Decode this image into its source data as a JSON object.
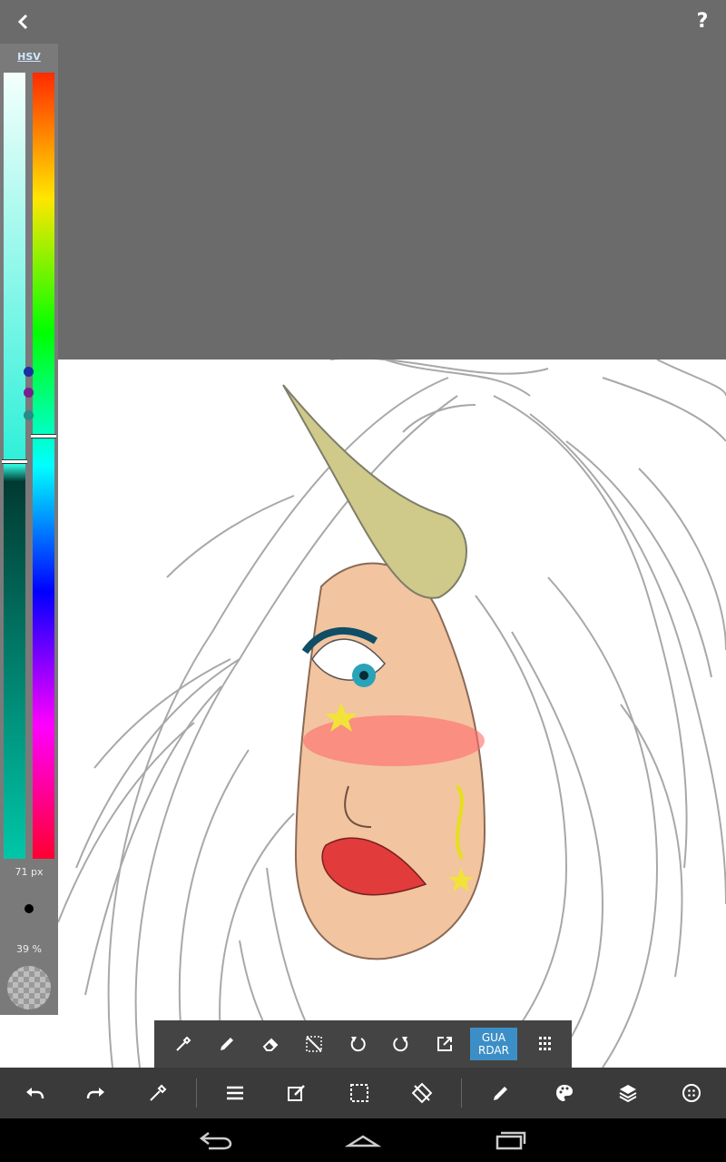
{
  "header": {
    "help_label": "?"
  },
  "color_panel": {
    "mode_label": "HSV",
    "brush_size": "71 px",
    "opacity": "39 %"
  },
  "toolbar": {
    "save_label": "GUA\nRDAR"
  },
  "colors": {
    "accent": "#3c8fc6",
    "selected_color": "#2cf0d8",
    "toolbar_bg": "#444444",
    "bottombar_bg": "#3a3a3a"
  }
}
